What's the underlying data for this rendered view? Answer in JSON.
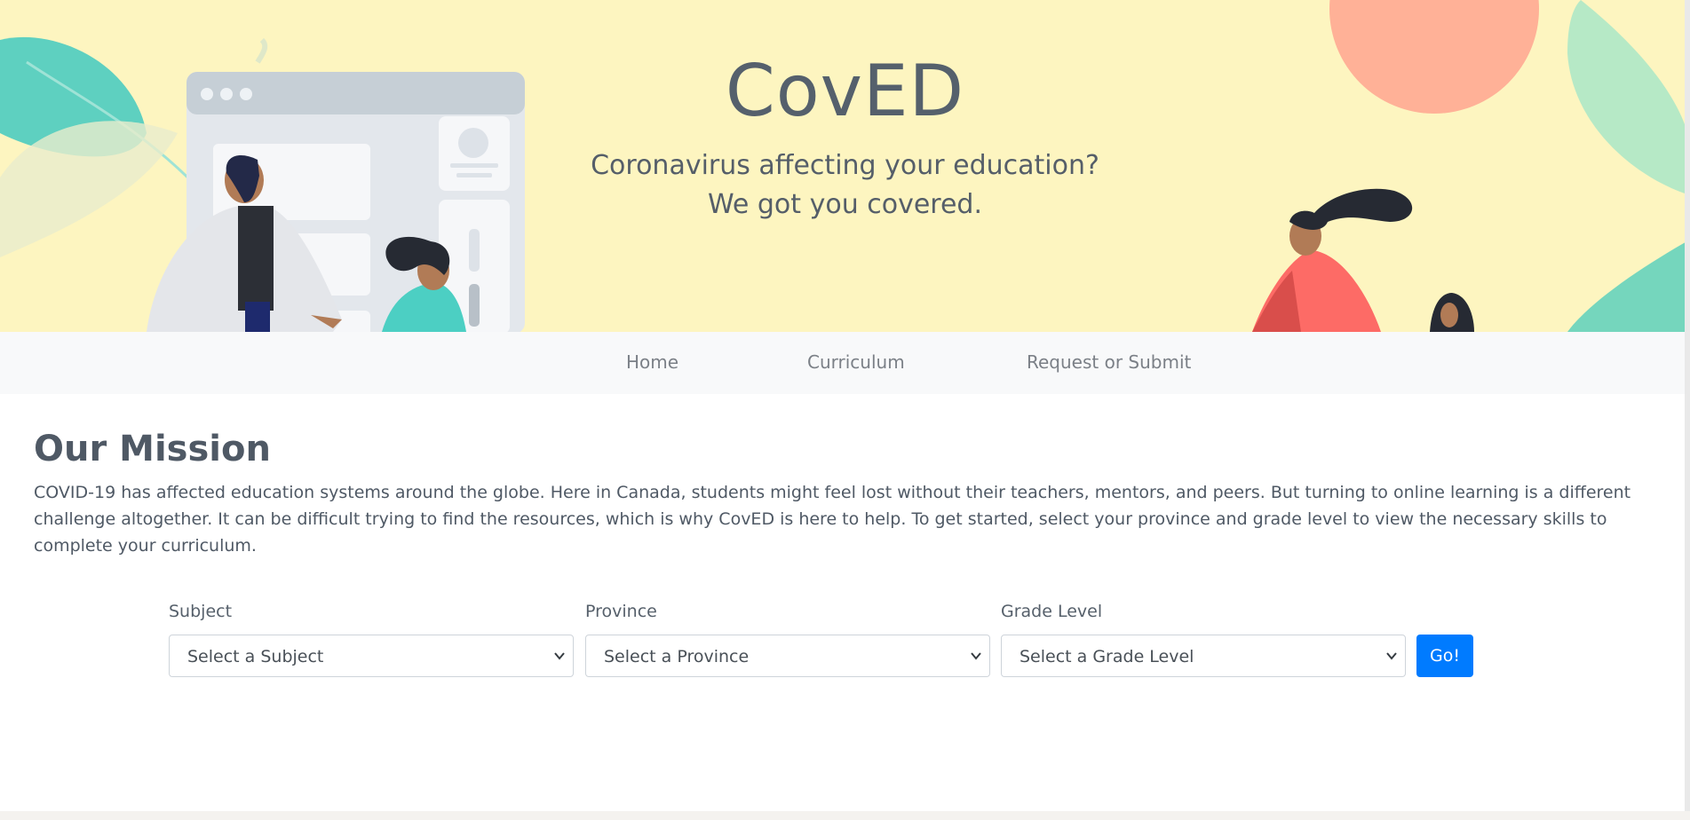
{
  "hero": {
    "title": "CovED",
    "tagline_line1": "Coronavirus affecting your education?",
    "tagline_line2": "We got you covered."
  },
  "nav": {
    "items": [
      {
        "label": "Home"
      },
      {
        "label": "Curriculum"
      },
      {
        "label": "Request or Submit"
      }
    ]
  },
  "mission": {
    "title": "Our Mission",
    "text": "COVID-19 has affected education systems around the globe. Here in Canada, students might feel lost without their teachers, mentors, and peers. But turning to online learning is a different challenge altogether. It can be difficult trying to find the resources, which is why CovED is here to help. To get started, select your province and grade level to view the necessary skills to complete your curriculum."
  },
  "form": {
    "subject": {
      "label": "Subject",
      "value": "Select a Subject"
    },
    "province": {
      "label": "Province",
      "value": "Select a Province"
    },
    "grade": {
      "label": "Grade Level",
      "value": "Select a Grade Level"
    },
    "go_label": "Go!"
  },
  "colors": {
    "hero_bg": "#fdf5c0",
    "accent": "#007bff",
    "nav_bg": "#f8f9fa",
    "text": "#4f5965"
  }
}
